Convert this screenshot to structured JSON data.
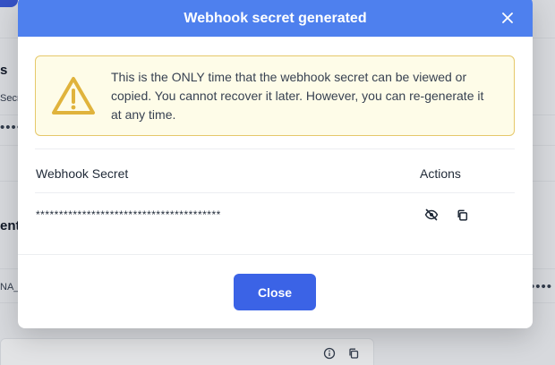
{
  "background": {
    "section_heading": "s",
    "field_label": "Secr",
    "masked_dots": "••••",
    "section_heading_2": "enti",
    "row_text": "NA_",
    "right_dots": "••••"
  },
  "modal": {
    "title": "Webhook secret generated",
    "close_icon": "close-icon"
  },
  "alert": {
    "icon": "warning-icon",
    "message": "This is the ONLY time that the webhook secret can be viewed or copied. You cannot recover it later. However, you can re-generate it at any time."
  },
  "table": {
    "columns": [
      "Webhook Secret",
      "Actions"
    ],
    "rows": [
      {
        "secret": "****************************************",
        "actions": [
          "eye-off-icon",
          "copy-icon"
        ]
      }
    ]
  },
  "footer": {
    "close_label": "Close"
  },
  "colors": {
    "header": "#4e80ee",
    "primary_button": "#3b63e6",
    "alert_bg": "#fefce8",
    "alert_border": "#e6c86a",
    "warning_icon": "#e0b33c"
  }
}
